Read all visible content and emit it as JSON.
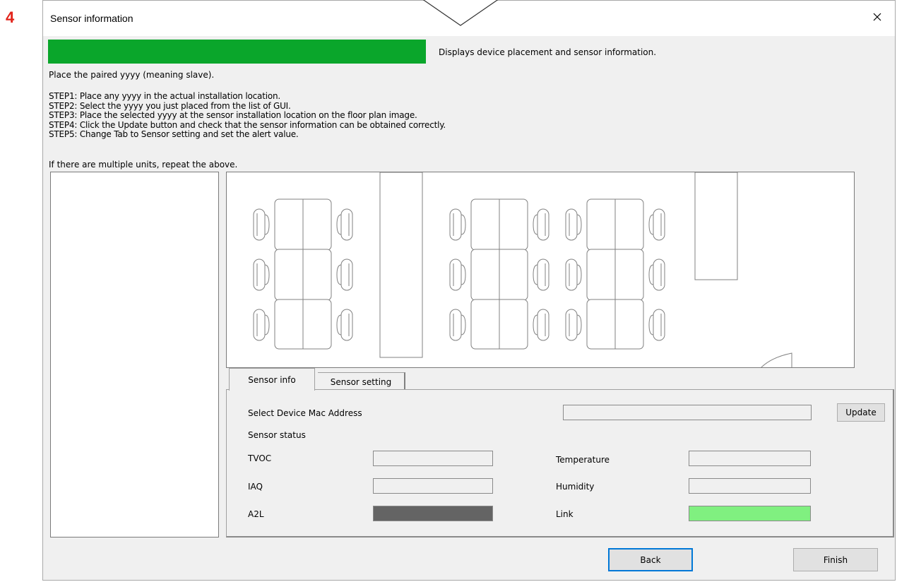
{
  "step_number": "4",
  "window": {
    "title": "Sensor information",
    "close_glyph": "×"
  },
  "banner": {
    "color": "#0aa62b",
    "description": "Displays device placement and sensor information."
  },
  "instructions": {
    "intro": "Place the paired yyyy (meaning slave).",
    "steps": [
      "STEP1: Place any yyyy in the actual installation location.",
      "STEP2: Select the yyyy you just placed from the list of GUI.",
      "STEP3: Place the selected yyyy at the sensor installation location on the floor plan image.",
      "STEP4: Click the Update button and check that the sensor information can be obtained correctly.",
      "STEP5: Change Tab to Sensor setting and set the alert value."
    ],
    "outro": "If there are multiple units, repeat the above."
  },
  "tabs": [
    {
      "label": "Sensor info",
      "active": true
    },
    {
      "label": "Sensor setting",
      "active": false
    }
  ],
  "sensor_info": {
    "mac_label": "Select Device Mac Address",
    "mac_value": "",
    "update_button": "Update",
    "status_heading": "Sensor status",
    "tvoc_label": "TVOC",
    "tvoc_value": "",
    "iaq_label": "IAQ",
    "iaq_value": "",
    "a2l_label": "A2L",
    "a2l_color": "#646464",
    "temperature_label": "Temperature",
    "temperature_value": "",
    "humidity_label": "Humidity",
    "humidity_value": "",
    "link_label": "Link",
    "link_color": "#80f080"
  },
  "footer": {
    "back_button": "Back",
    "finish_button": "Finish"
  }
}
